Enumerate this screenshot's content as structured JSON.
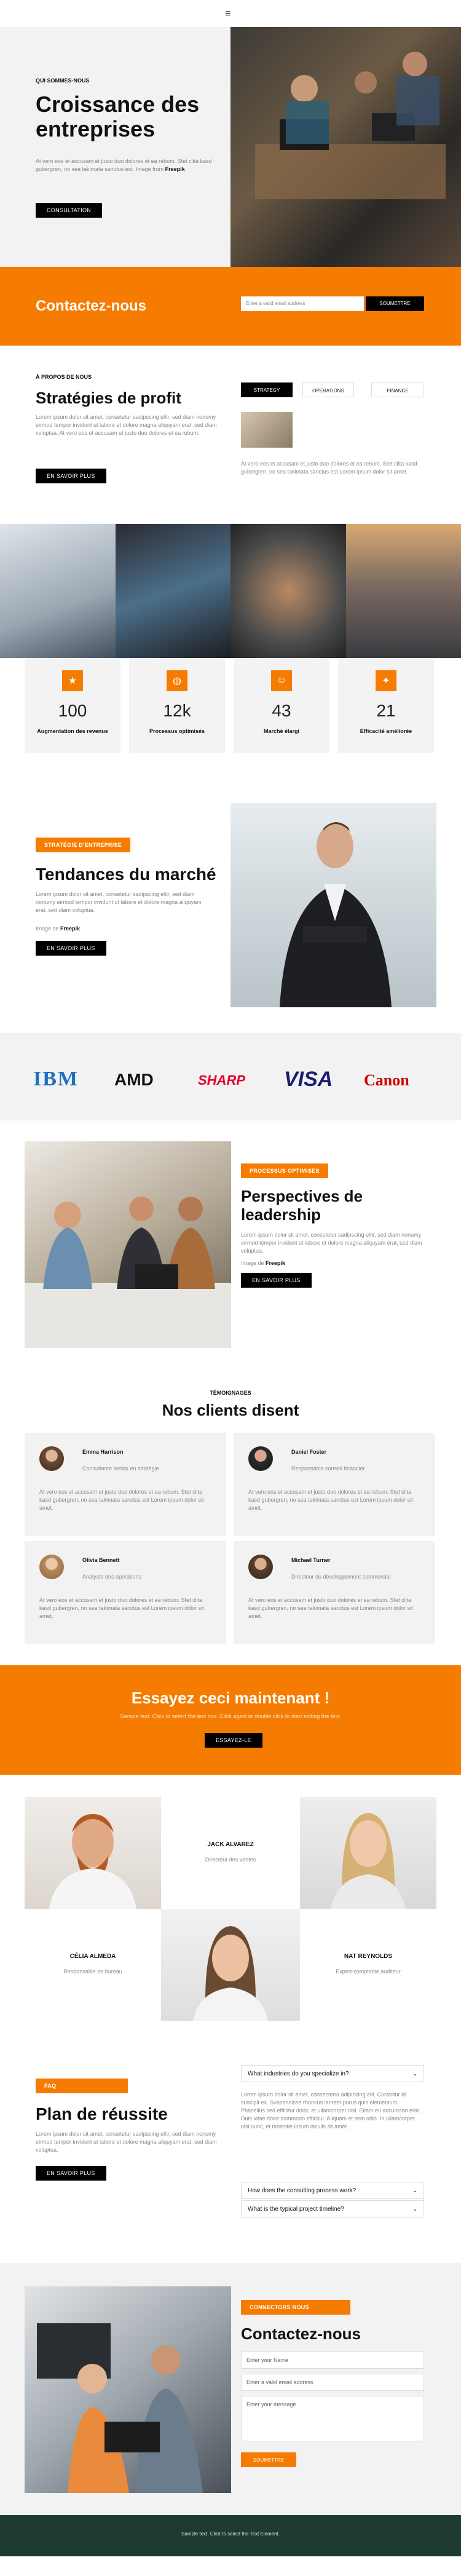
{
  "nav": {
    "menu_icon": "hamburger-icon"
  },
  "hero": {
    "eyebrow": "QUI SOMMES-NOUS",
    "title": "Croissance des entreprises",
    "body": "At vero eos et accusam et justo duo dolores et ea rebum. Stet clita kasd gubergren, no sea takimata sanctus est. Image from",
    "body_link": "Freepik",
    "button": "CONSULTATION"
  },
  "contact_bar": {
    "title": "Contactez-nous",
    "placeholder": "Enter a valid email address",
    "button": "SOUMETTRE"
  },
  "about": {
    "eyebrow": "À PROPOS DE NOUS",
    "title": "Stratégies de profit",
    "body": "Lorem ipsum dolor sit amet, consetetur sadipscing elitr, sed diam nonumy eirmod tempor invidunt ut labore et dolore magna aliquyam erat, sed diam voluptua. At vero eos et accusam et justo duo dolores et ea rebum.",
    "button": "EN SAVOIR PLUS",
    "tabs": [
      "STRATEGY",
      "OPERATIONS",
      "FINANCE"
    ],
    "tab_text": "At vero eos et accusam et justo duo dolores et ea rebum. Stet clita kasd gubergren, no sea takimata sanctus est Lorem ipsum dolor sit amet."
  },
  "stats": [
    {
      "icon": "star-icon",
      "value": "100",
      "label": "Augmentation des revenus"
    },
    {
      "icon": "globe-icon",
      "value": "12k",
      "label": "Processus optimisés"
    },
    {
      "icon": "user-icon",
      "value": "43",
      "label": "Marché élargi"
    },
    {
      "icon": "lightbulb-icon",
      "value": "21",
      "label": "Efficacité améliorée"
    }
  ],
  "trends": {
    "tag": "STRATÉGIE D'ENTREPRISE",
    "title": "Tendances du marché",
    "body": "Lorem ipsum dolor sit amet, consetetur sadipscing elitr, sed diam nonumy eirmod tempor invidunt ut labore et dolore magna aliquyam erat, sed diam voluptua.",
    "credit": "Image de",
    "credit_link": "Freepik",
    "button": "EN SAVOIR PLUS"
  },
  "logos": [
    "IBM",
    "AMD",
    "SHARP",
    "VISA",
    "Canon"
  ],
  "leadership": {
    "tag": "PROCESSUS OPTIMISÉS",
    "title": "Perspectives de leadership",
    "body": "Lorem ipsum dolor sit amet, consetetur sadipscing elitr, sed diam nonumy eirmod tempor invidunt ut labore et dolore magna aliquyam erat, sed diam voluptua.",
    "credit": "Image de",
    "credit_link": "Freepik",
    "button": "EN SAVOIR PLUS"
  },
  "testimonials": {
    "eyebrow": "TÉMOIGNAGES",
    "title": "Nos clients disent",
    "quote": "At vero eos et accusam et justo duo dolores et ea rebum. Stet clita kasd gubergren, no sea takimata sanctus est Lorem ipsum dolor sit amet.",
    "items": [
      {
        "name": "Emma Harrison",
        "role": "Consultante senior en stratégie"
      },
      {
        "name": "Daniel Foster",
        "role": "Responsable conseil financier"
      },
      {
        "name": "Olivia Bennett",
        "role": "Analyste des opérations"
      },
      {
        "name": "Michael Turner",
        "role": "Directeur du développement commercial"
      }
    ]
  },
  "cta": {
    "title": "Essayez ceci maintenant !",
    "body": "Sample text. Click to select the text box. Click again or double click to start editing the text.",
    "button": "ESSAYEZ-LE"
  },
  "team": [
    {
      "name": "JACK ALVAREZ",
      "role": "Directeur des ventes"
    },
    {
      "name": "CÉLIA ALMEDA",
      "role": "Responsable de bureau"
    },
    {
      "name": "NAT REYNOLDS",
      "role": "Expert-comptable auditeur"
    }
  ],
  "faq": {
    "tag": "FAQ",
    "title": "Plan de réussite",
    "body": "Lorem ipsum dolor sit amet, consetetur sadipscing elitr, sed diam nonumy eirmod tempor invidunt ut labore et dolore magna aliquyam erat, sed diam voluptua.",
    "button": "EN SAVOIR PLUS",
    "q1": "What industries do you specialize in?",
    "a1": "Lorem ipsum dolor sit amet, consectetur adipiscing elit. Curabitur id suscipit ex. Suspendisse rhoncus laoreet purus quis elementum. Phasellus sed efficitur dolor, et ullamcorper nisi. Etiam eu accumsan erat. Duis vitae dolor commodo efficitur. Aliquam et sem odio. In ullamcorper nisi nunc, et molestie ipsum iaculis sit amet.",
    "q2": "How does the consulting process work?",
    "q3": "What is the typical project timeline?"
  },
  "contact_form": {
    "tag": "CONNECTORS NOUS",
    "title": "Contactez-nous",
    "name_placeholder": "Enter your Name",
    "email_placeholder": "Enter a valid email address",
    "message_placeholder": "Enter your message",
    "button": "SOUMETTRE"
  },
  "footer": {
    "text": "Sample text. Click to select the Text Element."
  },
  "colors": {
    "accent": "#f57c00",
    "dark_footer": "#1e3b30"
  }
}
